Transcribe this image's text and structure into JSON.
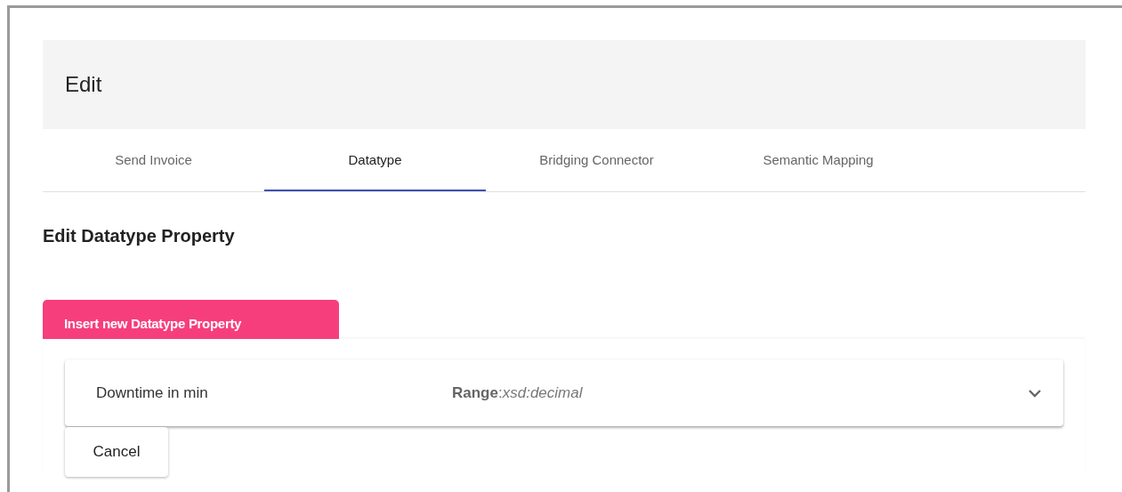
{
  "dialog": {
    "title": "Edit"
  },
  "tabs": [
    {
      "label": "Send Invoice",
      "selected": false
    },
    {
      "label": "Datatype",
      "selected": true
    },
    {
      "label": "Bridging Connector",
      "selected": false
    },
    {
      "label": "Semantic Mapping",
      "selected": false
    }
  ],
  "section": {
    "heading": "Edit Datatype Property",
    "insert_button": "Insert new Datatype Property"
  },
  "properties": [
    {
      "name": "Downtime in min",
      "range": "**Range**:*xsd:decimal*",
      "expanded": false
    }
  ],
  "buttons": [
    {
      "label": "Cancel"
    }
  ]
}
